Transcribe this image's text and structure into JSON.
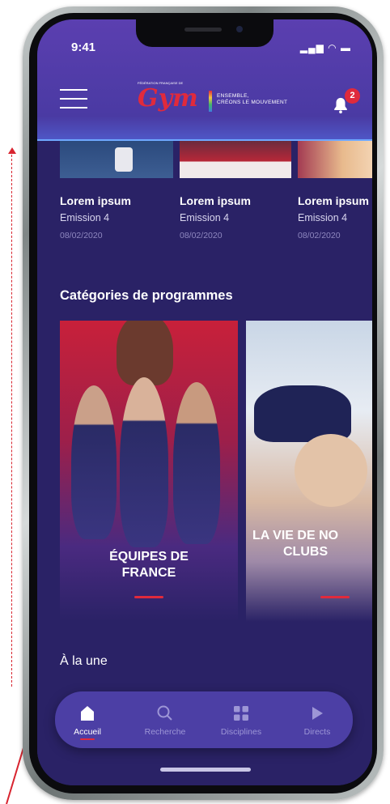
{
  "status_bar": {
    "time": "9:41"
  },
  "header": {
    "logo_federation": "FÉDÉRATION FRANÇAISE DE",
    "logo_brand": "Gym",
    "logo_tagline_1": "ENSEMBLE,",
    "logo_tagline_2": "CRÉONS LE MOUVEMENT",
    "notifications_count": "2"
  },
  "episodes": [
    {
      "title": "Lorem ipsum",
      "episode": "Emission 4",
      "date": "08/02/2020"
    },
    {
      "title": "Lorem ipsum",
      "episode": "Emission 4",
      "date": "08/02/2020"
    },
    {
      "title": "Lorem ipsum",
      "episode": "Emission 4",
      "date": "08/02/2020"
    }
  ],
  "categories": {
    "title": "Catégories de programmes",
    "items": [
      {
        "label_line1": "ÉQUIPES DE",
        "label_line2": "FRANCE"
      },
      {
        "label_line1": "LA VIE DE NO",
        "label_line2": "CLUBS"
      }
    ]
  },
  "featured": {
    "title": "À la une"
  },
  "navbar": {
    "items": [
      {
        "label": "Accueil",
        "icon": "home-icon",
        "active": true
      },
      {
        "label": "Recherche",
        "icon": "search-icon",
        "active": false
      },
      {
        "label": "Disciplines",
        "icon": "grid-icon",
        "active": false
      },
      {
        "label": "Directs",
        "icon": "play-icon",
        "active": false
      }
    ]
  },
  "colors": {
    "background": "#2a2266",
    "accent_red": "#e02a3c",
    "navbar": "#4c3fa5",
    "annotation": "#d8242f"
  }
}
